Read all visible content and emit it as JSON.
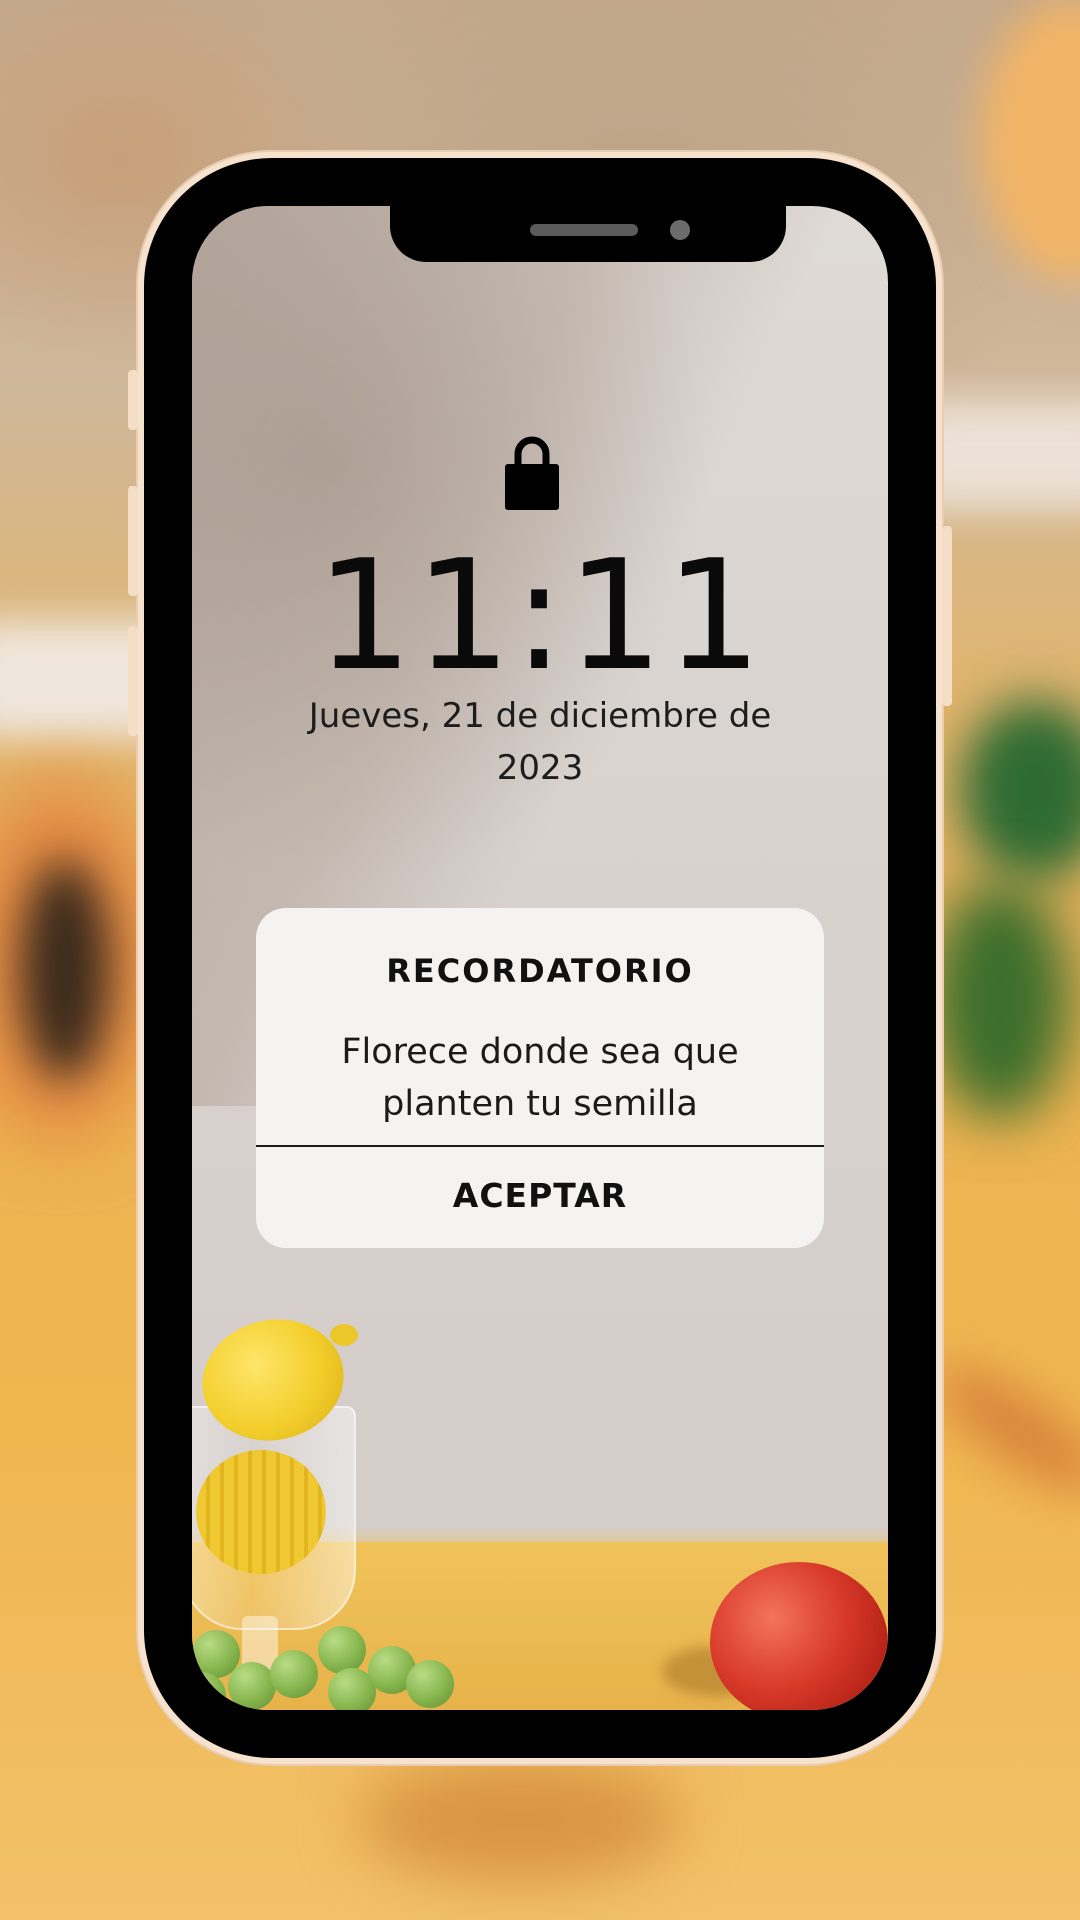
{
  "lockscreen": {
    "time": "11:11",
    "date": "Jueves, 21 de diciembre de 2023"
  },
  "notification": {
    "title": "RECORDATORIO",
    "message": "Florece donde sea que planten tu semilla",
    "button_label": "ACEPTAR"
  },
  "icons": {
    "lock": "lock-icon"
  },
  "colors": {
    "phone_frame": "#000000",
    "phone_rim": "#f6e2cd",
    "card_background": "#f4f3f2",
    "text": "#0a0a0a"
  }
}
